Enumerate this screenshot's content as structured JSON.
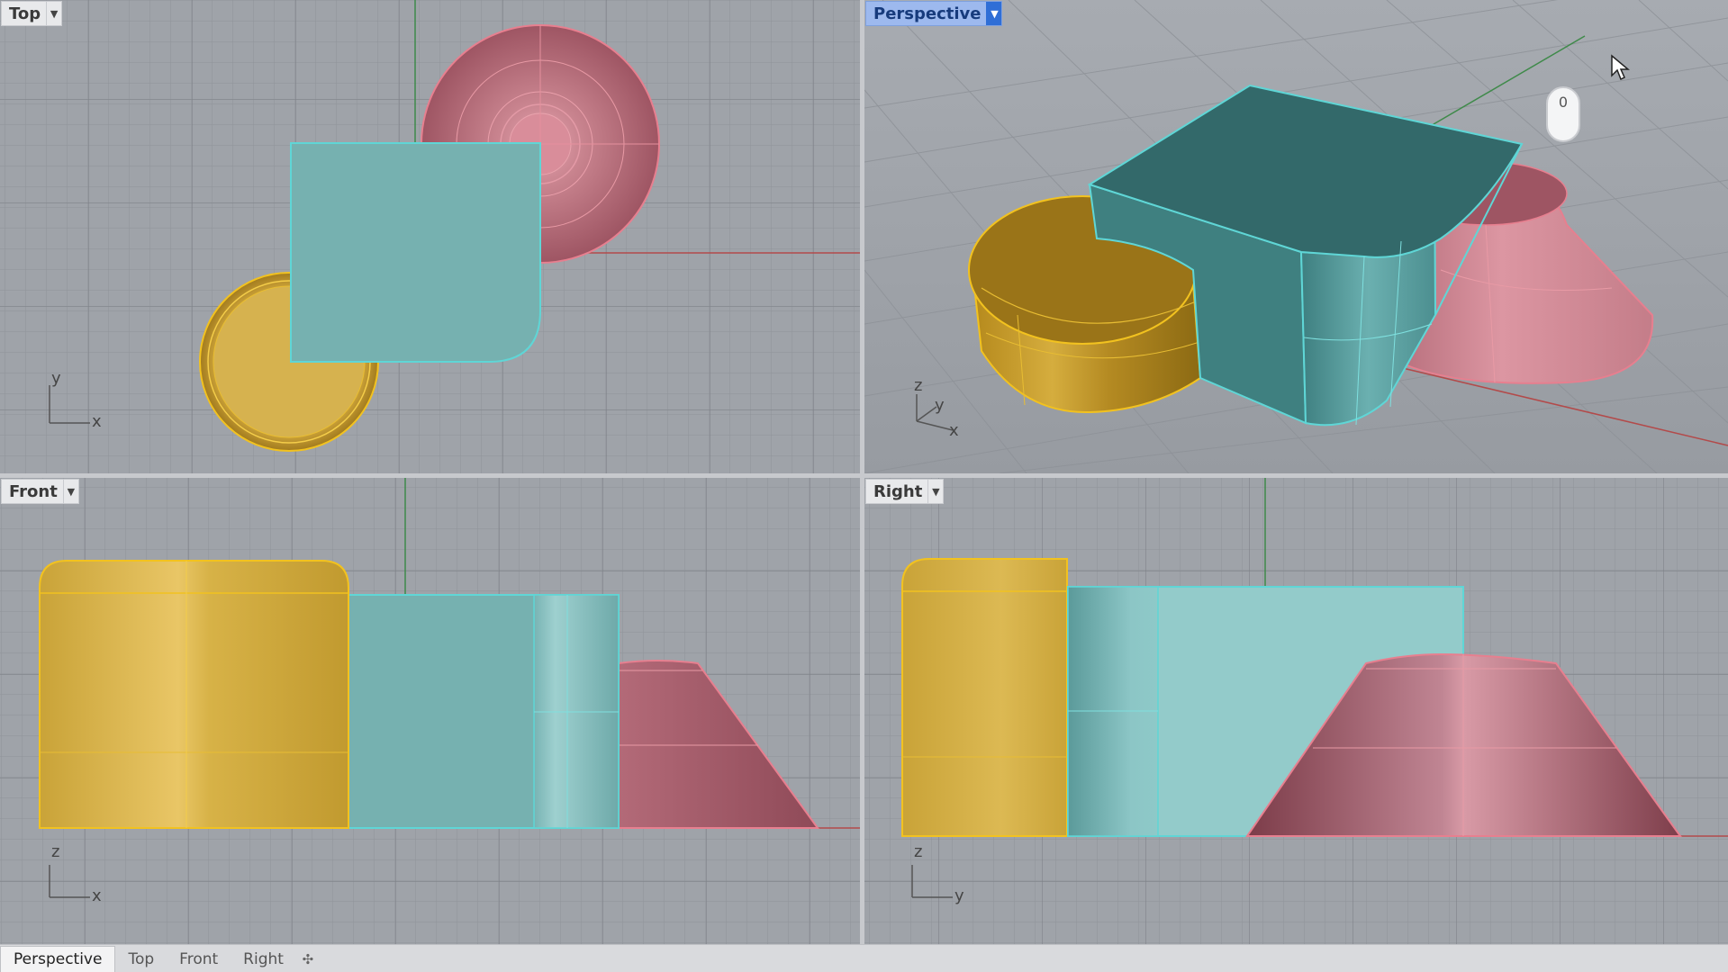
{
  "viewports": {
    "top": {
      "label": "Top",
      "axis_x": "x",
      "axis_y": "y"
    },
    "perspective": {
      "label": "Perspective",
      "axis_x": "x",
      "axis_y": "y",
      "axis_z": "z"
    },
    "front": {
      "label": "Front",
      "axis_x": "x",
      "axis_z": "z"
    },
    "right": {
      "label": "Right",
      "axis_y": "y",
      "axis_z": "z"
    }
  },
  "mouse_badge": "0",
  "tabs": [
    {
      "label": "Perspective",
      "active": true
    },
    {
      "label": "Top",
      "active": false
    },
    {
      "label": "Front",
      "active": false
    },
    {
      "label": "Right",
      "active": false
    }
  ],
  "colors": {
    "viewport_bg": "#9fa3a9",
    "grid": "#8f9399",
    "teal_box": "#76b1b0",
    "teal_edge": "#5fd6d6",
    "gold_cylinder": "#d9b84a",
    "gold_edge": "#f2c21f",
    "pink_cone": "#a95d6a",
    "pink_edge": "#e77f8f",
    "active_tab": "#2f6ed6"
  }
}
